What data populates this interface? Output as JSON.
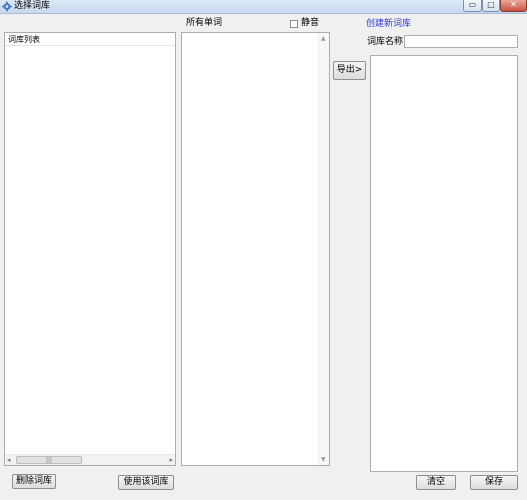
{
  "window": {
    "title": "选择词库",
    "min_glyph": "▭",
    "max_glyph": "□",
    "close_glyph": "✕"
  },
  "library_panel": {
    "header": "词库列表",
    "scroll_left": "◂",
    "scroll_right": "▸",
    "scroll_grip": "|||"
  },
  "words_panel": {
    "label": "所有单词",
    "mute_label": "静音",
    "scroll_up": "▲",
    "scroll_down": "▼"
  },
  "create_panel": {
    "link": "创建新词库",
    "name_label": "词库名称",
    "name_value": ""
  },
  "buttons": {
    "export": "导出>",
    "delete_library": "删除词库",
    "use_library": "使用该词库",
    "clear": "清空",
    "save": "保存"
  }
}
